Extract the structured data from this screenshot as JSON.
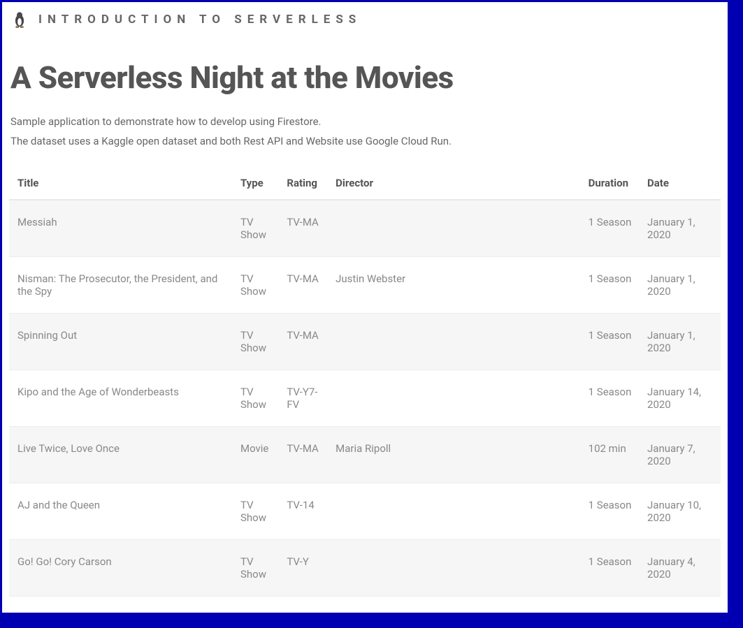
{
  "header": {
    "site_title": "INTRODUCTION TO SERVERLESS",
    "logo_name": "penguin-logo"
  },
  "main": {
    "title": "A Serverless Night at the Movies",
    "intro_line_1": "Sample application to demonstrate how to develop using Firestore.",
    "intro_line_2": "The dataset uses a Kaggle open dataset and both Rest API and Website use Google Cloud Run."
  },
  "table": {
    "headers": {
      "title": "Title",
      "type": "Type",
      "rating": "Rating",
      "director": "Director",
      "duration": "Duration",
      "date": "Date"
    },
    "rows": [
      {
        "title": "Messiah",
        "type": "TV Show",
        "rating": "TV-MA",
        "director": "",
        "duration": "1 Season",
        "date": "January 1, 2020"
      },
      {
        "title": "Nisman: The Prosecutor, the President, and the Spy",
        "type": "TV Show",
        "rating": "TV-MA",
        "director": "Justin Webster",
        "duration": "1 Season",
        "date": "January 1, 2020"
      },
      {
        "title": "Spinning Out",
        "type": "TV Show",
        "rating": "TV-MA",
        "director": "",
        "duration": "1 Season",
        "date": "January 1, 2020"
      },
      {
        "title": "Kipo and the Age of Wonderbeasts",
        "type": "TV Show",
        "rating": "TV-Y7-FV",
        "director": "",
        "duration": "1 Season",
        "date": "January 14, 2020"
      },
      {
        "title": "Live Twice, Love Once",
        "type": "Movie",
        "rating": "TV-MA",
        "director": "Maria Ripoll",
        "duration": "102 min",
        "date": "January 7, 2020"
      },
      {
        "title": "AJ and the Queen",
        "type": "TV Show",
        "rating": "TV-14",
        "director": "",
        "duration": "1 Season",
        "date": "January 10, 2020"
      },
      {
        "title": "Go! Go! Cory Carson",
        "type": "TV Show",
        "rating": "TV-Y",
        "director": "",
        "duration": "1 Season",
        "date": "January 4, 2020"
      }
    ]
  }
}
